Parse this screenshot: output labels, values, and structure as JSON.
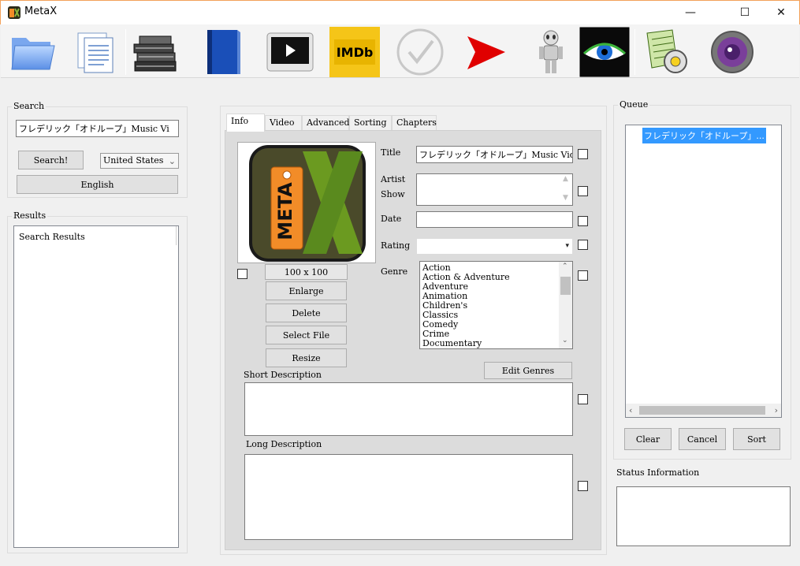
{
  "window": {
    "title": "MetaX"
  },
  "search": {
    "group_label": "Search",
    "query": "フレデリック「オドループ」Music Vi",
    "search_button": "Search!",
    "region": "United States",
    "language": "English"
  },
  "results": {
    "group_label": "Results",
    "placeholder": "Search Results"
  },
  "tabs": [
    "Info",
    "Video",
    "Advanced",
    "Sorting",
    "Chapters"
  ],
  "info": {
    "artwork_size": "100 x 100",
    "enlarge_button": "Enlarge",
    "delete_button": "Delete",
    "select_file_button": "Select File",
    "resize_button": "Resize",
    "title_label": "Title",
    "title_value": "フレデリック「オドループ」Music Vid",
    "artist_label_1": "Artist",
    "artist_label_2": "Show",
    "date_label": "Date",
    "rating_label": "Rating",
    "genre_label": "Genre",
    "genres": [
      "Action",
      "Action & Adventure",
      "Adventure",
      "Animation",
      "Children's",
      "Classics",
      "Comedy",
      "Crime",
      "Documentary"
    ],
    "edit_genres_button": "Edit Genres",
    "short_description_label": "Short Description",
    "long_description_label": "Long Description",
    "artwork_text": "META"
  },
  "queue": {
    "group_label": "Queue",
    "items": [
      "フレデリック「オドループ」..."
    ],
    "clear_button": "Clear",
    "cancel_button": "Cancel",
    "sort_button": "Sort"
  },
  "status": {
    "label": "Status Information"
  },
  "colors": {
    "selection": "#3399ff",
    "artwork_orange": "#f28c28",
    "artwork_green": "#5a8a1e"
  }
}
